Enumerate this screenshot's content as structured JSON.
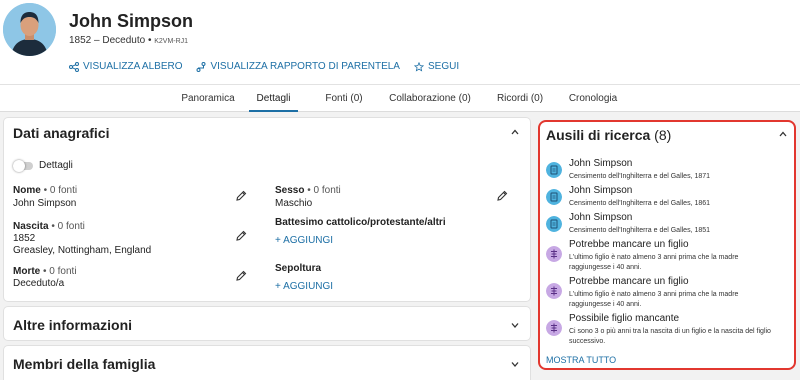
{
  "person": {
    "name": "John Simpson",
    "dates": "1852 – Deceduto",
    "id": "K2VM-RJ1"
  },
  "actions": [
    {
      "label": "VISUALIZZA ALBERO",
      "icon": "tree-icon"
    },
    {
      "label": "VISUALIZZA RAPPORTO DI PARENTELA",
      "icon": "relationship-icon"
    },
    {
      "label": "SEGUI",
      "icon": "star-icon"
    }
  ],
  "tabs": [
    {
      "label": "Panoramica",
      "active": false
    },
    {
      "label": "Dettagli",
      "active": true
    },
    {
      "label": "Fonti (0)",
      "active": false
    },
    {
      "label": "Collaborazione (0)",
      "active": false
    },
    {
      "label": "Ricordi (0)",
      "active": false
    },
    {
      "label": "Cronologia",
      "active": false
    }
  ],
  "vitals": {
    "title": "Dati anagrafici",
    "toggle_label": "Dettagli",
    "name": {
      "label": "Nome",
      "sources": "• 0 fonti",
      "value": "John Simpson"
    },
    "birth": {
      "label": "Nascita",
      "sources": "• 0 fonti",
      "value1": "1852",
      "value2": "Greasley, Nottingham, England"
    },
    "death": {
      "label": "Morte",
      "sources": "• 0 fonti",
      "value": "Deceduto/a"
    },
    "sex": {
      "label": "Sesso",
      "sources": "• 0 fonti",
      "value": "Maschio"
    },
    "christening": {
      "label": "Battesimo cattolico/protestante/altri",
      "add": "+ AGGIUNGI"
    },
    "burial": {
      "label": "Sepoltura",
      "add": "+ AGGIUNGI"
    }
  },
  "other_info": {
    "title": "Altre informazioni"
  },
  "family": {
    "title": "Membri della famiglia"
  },
  "research": {
    "title": "Ausili di ricerca",
    "count": "(8)",
    "show_all": "MOSTRA TUTTO",
    "items": [
      {
        "type": "record",
        "title": "John Simpson",
        "desc": "Censimento dell'Inghilterra e del Galles, 1871"
      },
      {
        "type": "record",
        "title": "John Simpson",
        "desc": "Censimento dell'Inghilterra e del Galles, 1861"
      },
      {
        "type": "record",
        "title": "John Simpson",
        "desc": "Censimento dell'Inghilterra e del Galles, 1851"
      },
      {
        "type": "hint",
        "title": "Potrebbe mancare un figlio",
        "desc": "L'ultimo figlio è nato almeno 3 anni prima che la madre raggiungesse i 40 anni."
      },
      {
        "type": "hint",
        "title": "Potrebbe mancare un figlio",
        "desc": "L'ultimo figlio è nato almeno 3 anni prima che la madre raggiungesse i 40 anni."
      },
      {
        "type": "hint",
        "title": "Possibile figlio mancante",
        "desc": "Ci sono 3 o più anni tra la nascita di un figlio e la nascita del figlio successivo."
      }
    ]
  },
  "colors": {
    "link": "#1d6fa5",
    "highlight": "#e2372f",
    "record_icon": "#4fb3df",
    "hint_icon": "#c7a8e4"
  }
}
